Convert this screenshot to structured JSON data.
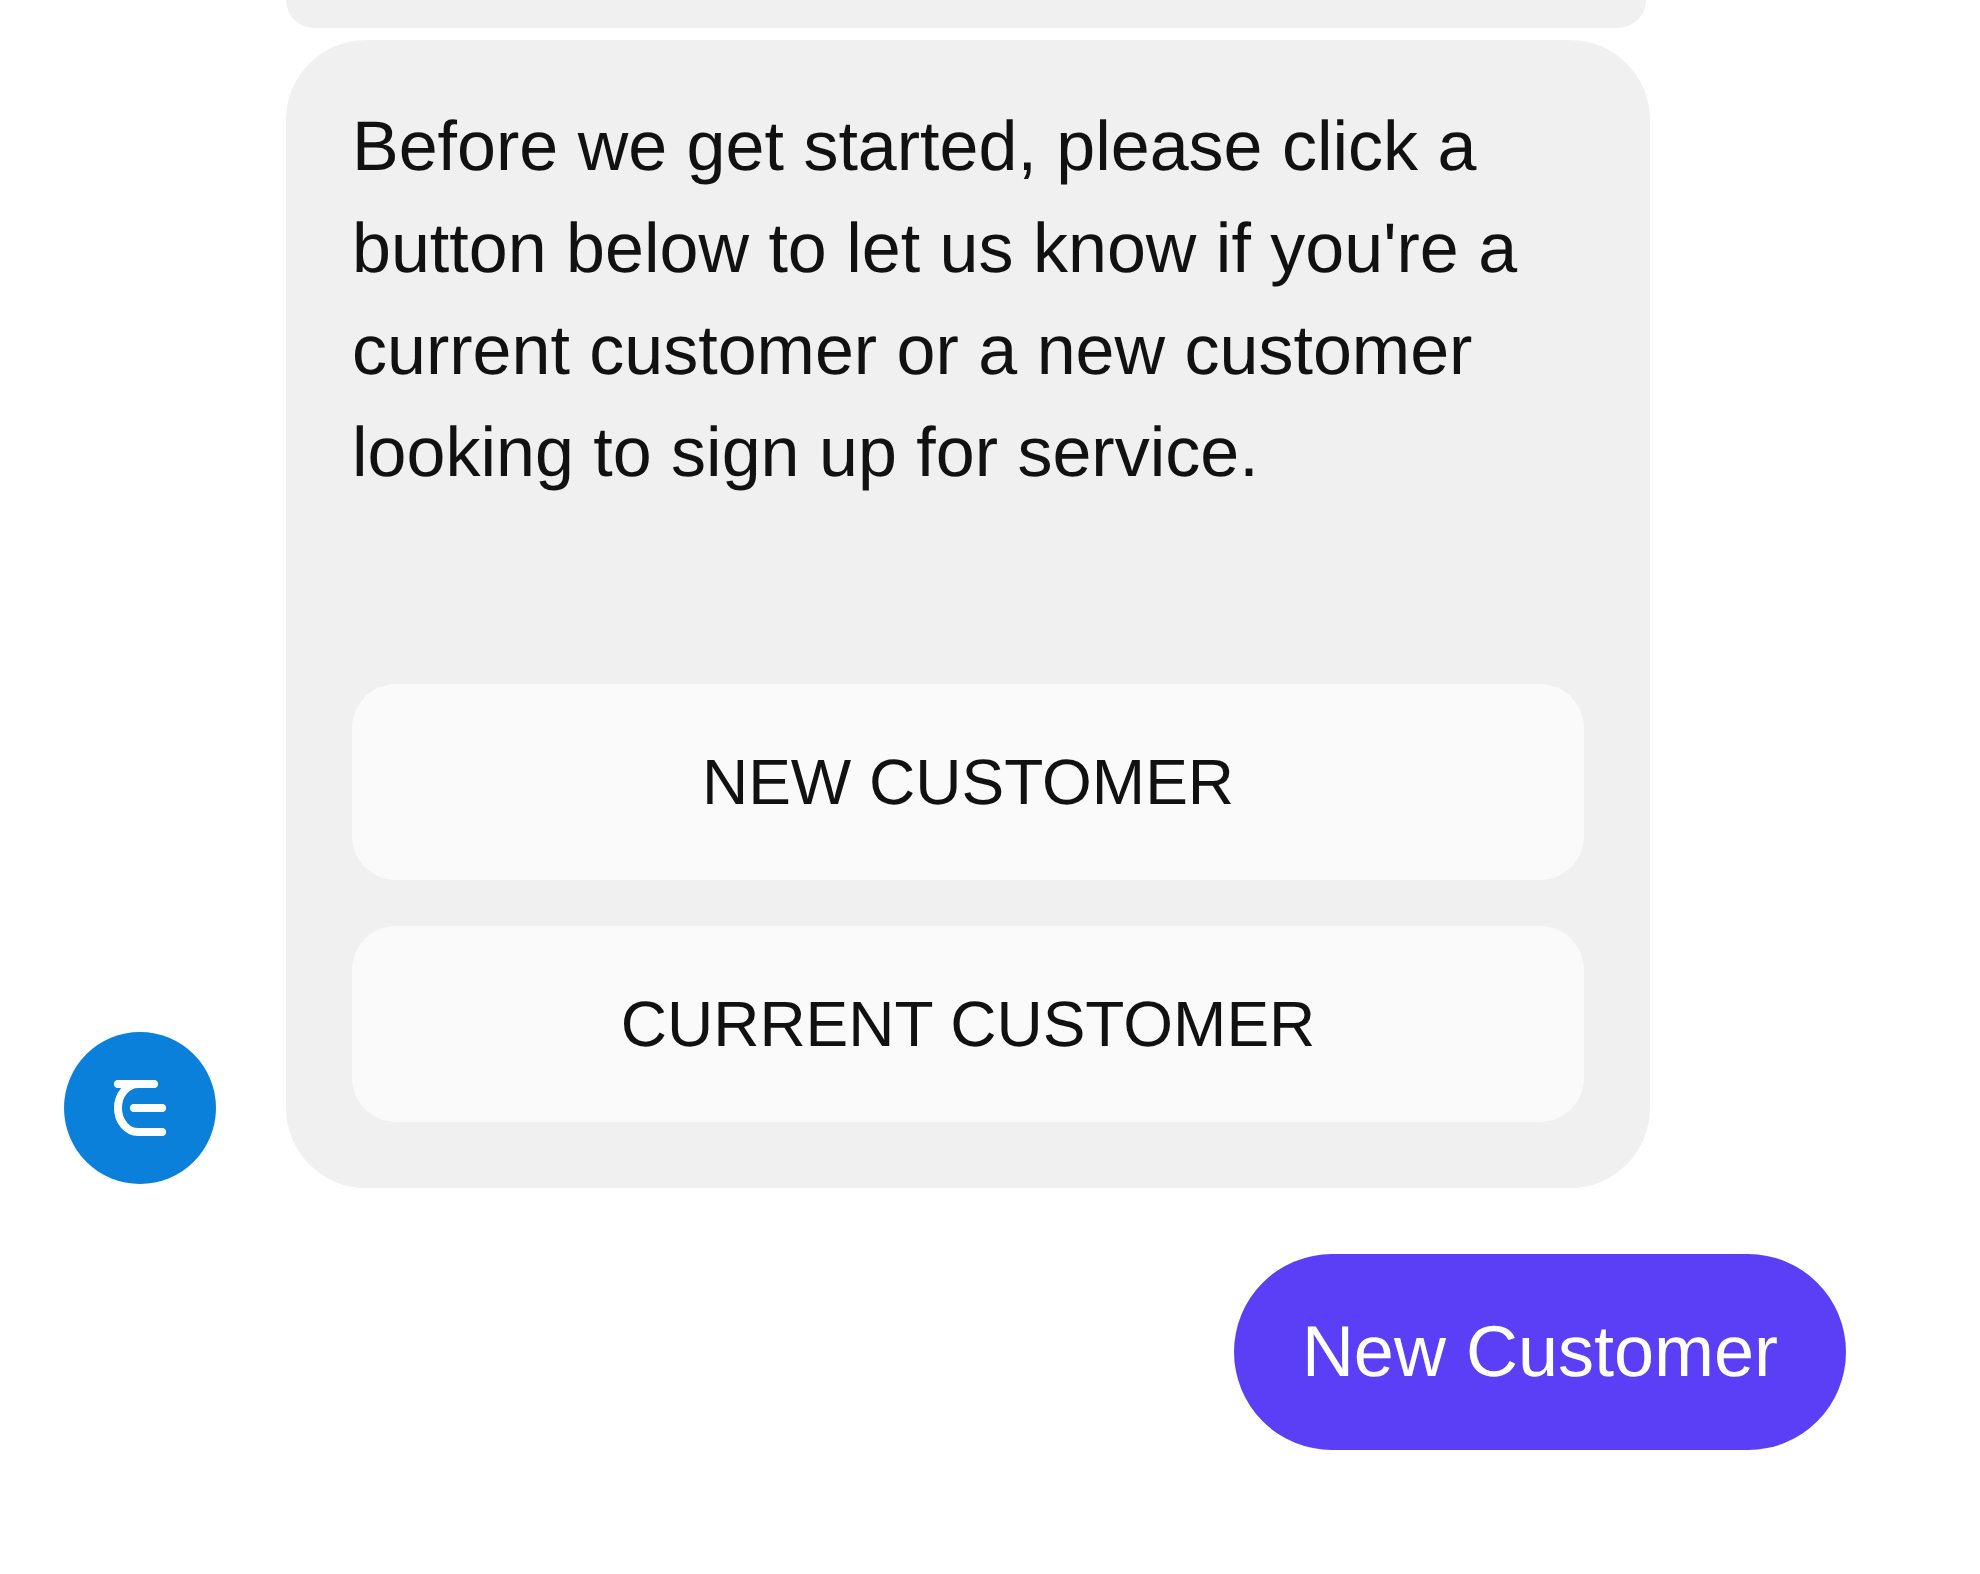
{
  "messages": [
    {
      "kind": "partial"
    },
    {
      "kind": "bot",
      "text": "Before we get started, please click a button below to let us know if you're a current customer or a new customer looking to sign up for service.",
      "buttons": [
        "NEW CUSTOMER",
        "CURRENT CUSTOMER"
      ]
    },
    {
      "kind": "user",
      "text": "New Customer"
    }
  ]
}
